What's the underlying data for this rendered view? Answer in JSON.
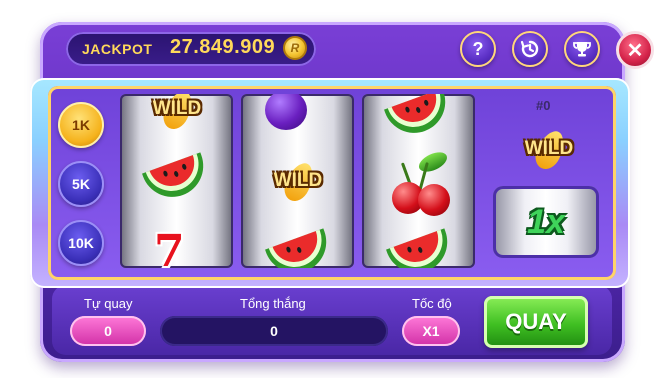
{
  "top_bar": {
    "jackpot_label": "JACKPOT",
    "jackpot_value": "27.849.909",
    "coin_symbol": "R",
    "help_icon": "question-icon",
    "history_icon": "history-icon",
    "trophy_icon": "trophy-icon",
    "close_icon": "close-icon"
  },
  "bet_options": [
    "1K",
    "5K",
    "10K"
  ],
  "selected_bet": "1K",
  "reels": [
    [
      "wild",
      "watermelon",
      "seven"
    ],
    [
      "plum",
      "wild",
      "watermelon"
    ],
    [
      "watermelon",
      "cherries",
      "watermelon"
    ]
  ],
  "wild_label": "WILD",
  "seven_label": "7",
  "bonus": {
    "counter": "#0",
    "multiplier": "1x"
  },
  "controls": {
    "auto_spin_label": "Tự quay",
    "auto_spin_value": "0",
    "total_win_label": "Tổng thắng",
    "total_win_value": "0",
    "speed_label": "Tốc độ",
    "speed_value": "X1",
    "spin_label": "QUAY"
  },
  "colors": {
    "frame": "#5a2ab8",
    "gold": "#ffd95a",
    "spin_green": "#3fbf22",
    "pink": "#d12fa6"
  }
}
